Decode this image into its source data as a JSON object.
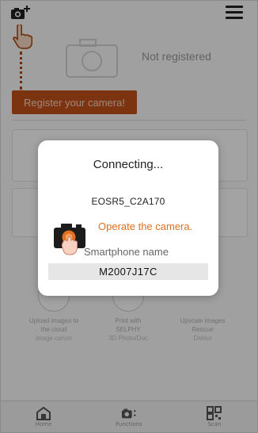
{
  "header": {
    "add_camera_icon": "camera-plus-icon",
    "menu_icon": "hamburger-menu-icon"
  },
  "registration": {
    "status_text": "Not registered",
    "register_button_label": "Register your camera!"
  },
  "background_features": [
    {
      "line1": "Upload images to",
      "line2": "the cloud",
      "line3": "image.canon"
    },
    {
      "line1": "Print with",
      "line2": "SELPHY",
      "line3": "3D Photo/Doc"
    },
    {
      "line1": "Upscale images",
      "line2": "Rescue",
      "line3": "Deblur"
    }
  ],
  "bottom_nav": [
    {
      "icon": "home-icon",
      "label": "Home"
    },
    {
      "icon": "camera-functions-icon",
      "label": "Functions"
    },
    {
      "icon": "qr-code-icon",
      "label": "Scan"
    }
  ],
  "dialog": {
    "title": "Connecting...",
    "camera_name": "EOSR5_C2A170",
    "instruction": "Operate the camera.",
    "smartphone_label": "Smartphone name",
    "smartphone_value": "M2007J17C"
  },
  "colors": {
    "accent_orange": "#e07020",
    "register_button_bg": "#c0501a",
    "overlay": "rgba(0,0,0,0.36)"
  }
}
